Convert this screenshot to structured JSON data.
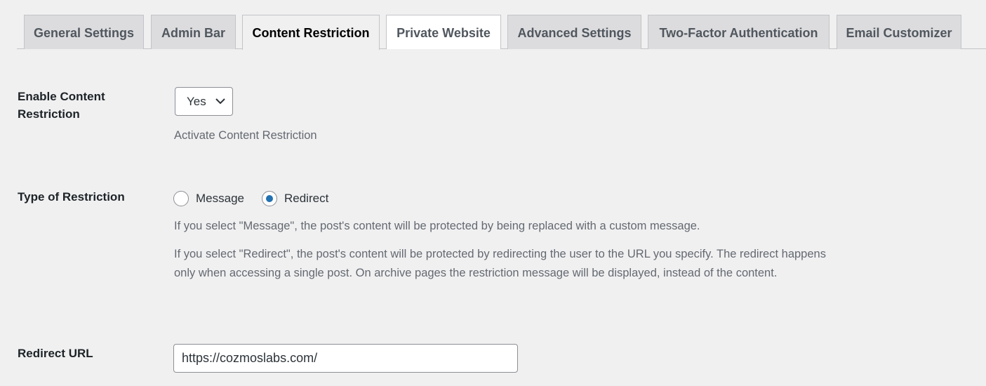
{
  "tabs": [
    {
      "label": "General Settings",
      "state": "inactive"
    },
    {
      "label": "Admin Bar",
      "state": "inactive"
    },
    {
      "label": "Content Restriction",
      "state": "active"
    },
    {
      "label": "Private Website",
      "state": "hover"
    },
    {
      "label": "Advanced Settings",
      "state": "inactive"
    },
    {
      "label": "Two-Factor Authentication",
      "state": "inactive"
    },
    {
      "label": "Email Customizer",
      "state": "inactive"
    }
  ],
  "enable_restriction": {
    "label": "Enable Content Restriction",
    "selected": "Yes",
    "description": "Activate Content Restriction"
  },
  "restriction_type": {
    "label": "Type of Restriction",
    "options": [
      {
        "label": "Message",
        "checked": false
      },
      {
        "label": "Redirect",
        "checked": true
      }
    ],
    "description_message": "If you select \"Message\", the post's content will be protected by being replaced with a custom message.",
    "description_redirect": "If you select \"Redirect\", the post's content will be protected by redirecting the user to the URL you specify. The redirect happens only when accessing a single post. On archive pages the restriction message will be displayed, instead of the content."
  },
  "redirect_url": {
    "label": "Redirect URL",
    "value": "https://cozmoslabs.com/"
  },
  "colors": {
    "accent": "#2271b1",
    "background": "#f0f0f1",
    "tab_inactive": "#dcdcde"
  }
}
